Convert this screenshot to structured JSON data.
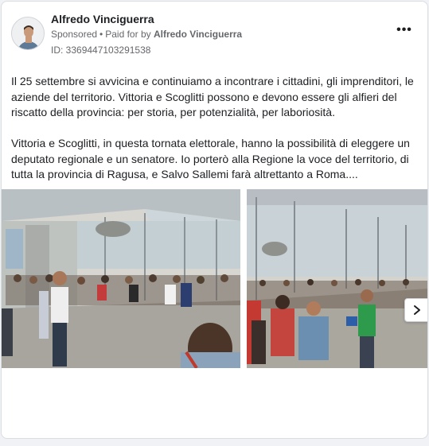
{
  "ad": {
    "advertiser_name": "Alfredo Vinciguerra",
    "sponsored_label": "Sponsored",
    "separator": "•",
    "paid_for_prefix": "Paid for by",
    "payer_name": "Alfredo Vinciguerra",
    "id_text": "ID: 3369447103291538",
    "more_icon": "more-horizontal-icon",
    "more_glyph": "•••"
  },
  "body": {
    "paragraphs": [
      "Il 25 settembre si avvicina e continuiamo a incontrare i cittadini, gli imprenditori, le aziende del territorio. Vittoria e Scoglitti possono e devono essere gli alfieri del riscatto della provincia: per storia, per potenzialità, per laboriosità.",
      "Vittoria e Scoglitti, in questa tornata elettorale, hanno la possibilità di eleggere un deputato regionale e un senatore. Io porterò alla Regione la voce del territorio, di tutta la provincia di Ragusa, e Salvo Sallemi farà altrettanto a Roma...."
    ]
  },
  "gallery": {
    "images": [
      "event-photo-1",
      "event-photo-2"
    ],
    "next_icon": "chevron-right-icon"
  },
  "colors": {
    "card_bg": "#ffffff",
    "page_bg": "#f0f2f5",
    "secondary_text": "#65676b",
    "primary_text": "#1c1e21"
  }
}
